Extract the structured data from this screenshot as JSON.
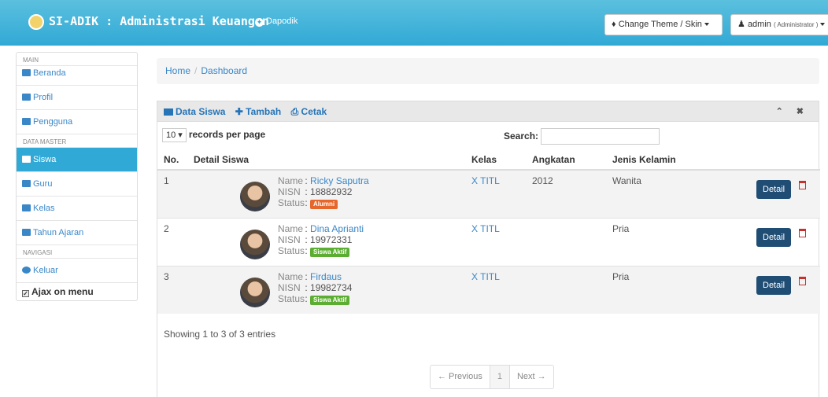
{
  "topbar": {
    "brand": "SI-ADIK : Administrasi Keuangan",
    "dapodik": "Dapodik",
    "theme_label": "Change Theme / Skin",
    "user_label": "admin",
    "user_role": "( Administrator )"
  },
  "sidebar": {
    "main_header": "MAIN",
    "main_items": [
      {
        "label": "Beranda",
        "icon": "home-icon"
      },
      {
        "label": "Profil",
        "icon": "user-icon"
      },
      {
        "label": "Pengguna",
        "icon": "book-icon"
      }
    ],
    "master_header": "DATA MASTER",
    "master_items": [
      {
        "label": "Siswa",
        "icon": "folder-icon",
        "active": true
      },
      {
        "label": "Guru",
        "icon": "folder-icon"
      },
      {
        "label": "Kelas",
        "icon": "folder-icon"
      },
      {
        "label": "Tahun Ajaran",
        "icon": "folder-icon"
      }
    ],
    "nav_header": "NAVIGASI",
    "nav_items": [
      {
        "label": "Keluar",
        "icon": "power-icon"
      }
    ],
    "ajax_label": "Ajax on menu"
  },
  "breadcrumb": {
    "home": "Home",
    "current": "Dashboard"
  },
  "panel": {
    "title": "Data Siswa",
    "add": "Tambah",
    "print": "Cetak",
    "per_page_value": "10",
    "per_page_suffix": "records per page",
    "search_label": "Search:",
    "columns": [
      "No.",
      "Detail Siswa",
      "Kelas",
      "Angkatan",
      "Jenis Kelamin"
    ],
    "rows": [
      {
        "no": "1",
        "name": "Ricky Saputra",
        "nisn": "18882932",
        "status": "Alumni",
        "status_color": "#e6672b",
        "kelas": "X TITL",
        "angkatan": "2012",
        "jk": "Wanita"
      },
      {
        "no": "2",
        "name": "Dina Aprianti",
        "nisn": "19972331",
        "status": "Siswa Aktif",
        "status_color": "#5cae32",
        "kelas": "X TITL",
        "angkatan": "",
        "jk": "Pria"
      },
      {
        "no": "3",
        "name": "Firdaus",
        "nisn": "19982734",
        "status": "Siswa Aktif",
        "status_color": "#5cae32",
        "kelas": "X TITL",
        "angkatan": "",
        "jk": "Pria"
      }
    ],
    "labels": {
      "name": "Name",
      "nisn": "NISN",
      "status": "Status",
      "sep": ":",
      "detail_btn": "Detail"
    },
    "info": "Showing 1 to 3 of 3 entries",
    "pager": {
      "prev": "← Previous",
      "page": "1",
      "next": "Next →"
    }
  }
}
